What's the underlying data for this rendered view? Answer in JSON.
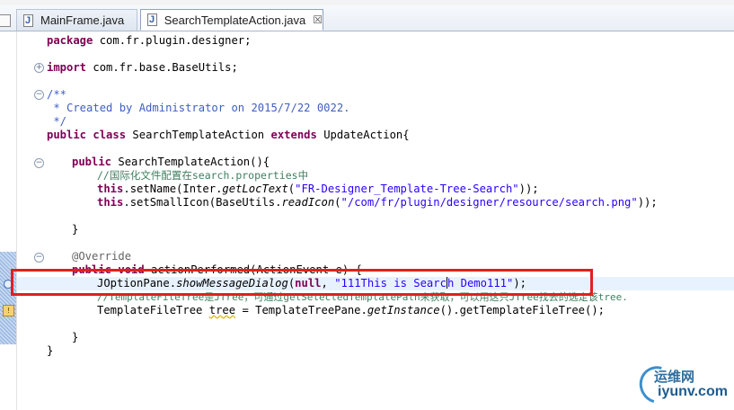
{
  "tabs": {
    "inactive_label": "MainFrame.java",
    "active_label": "SearchTemplateAction.java",
    "close_glyph": "☒"
  },
  "code": {
    "l1_kw": "package",
    "l1_rest": " com.fr.plugin.designer;",
    "l2_kw": "import",
    "l2_rest": " com.fr.base.BaseUtils;",
    "l3": "/**",
    "l4": " * Created by Administrator on 2015/7/22 0022.",
    "l5": " */",
    "l6_kw1": "public class",
    "l6_mid": " SearchTemplateAction ",
    "l6_kw2": "extends",
    "l6_rest": " UpdateAction{",
    "l7_kw": "public",
    "l7_rest": " SearchTemplateAction(){",
    "l8_comment_cn": "//国际化文件配置在",
    "l8_comment_en": "search.properties",
    "l8_comment_tail": "中",
    "l9_kw": "this",
    "l9_a": ".setName(Inter.",
    "l9_method": "getLocText",
    "l9_b": "(",
    "l9_str": "\"FR-Designer_Template-Tree-Search\"",
    "l9_c": "));",
    "l10_kw": "this",
    "l10_a": ".setSmallIcon(BaseUtils.",
    "l10_method": "readIcon",
    "l10_b": "(",
    "l10_str": "\"/com/fr/plugin/designer/resource/search.png\"",
    "l10_c": "));",
    "l11": "}",
    "l12": "@Override",
    "l13_kw": "public void",
    "l13_rest": " actionPerformed(ActionEvent e) {",
    "l14_a": "JOptionPane.",
    "l14_method": "showMessageDialog",
    "l14_b": "(",
    "l14_kw": "null",
    "l14_c": ", ",
    "l14_str1": "\"111This is Searc",
    "l14_str2": "h Demo111\"",
    "l14_d": ");",
    "l15": "//TemplateFileTree是JTree，可通过getSelectedTemplatePath来获取，可以用这只JTree找去的选定该tree.",
    "l16_a": "TemplateFileTree ",
    "l16_var": "tree",
    "l16_b": " = TemplateTreePane.",
    "l16_method": "getInstance",
    "l16_c": "().getTemplateFileTree();",
    "l17": "}",
    "l18": "}"
  },
  "watermark": {
    "cn": "运维网",
    "en": "iyunv.com"
  },
  "colors": {
    "keyword": "#7f0055",
    "javadoc": "#3f5fbf",
    "comment": "#3f7f5f",
    "string": "#2a00ff",
    "highlight_box": "#e02020",
    "current_line": "#e8f2fe"
  }
}
